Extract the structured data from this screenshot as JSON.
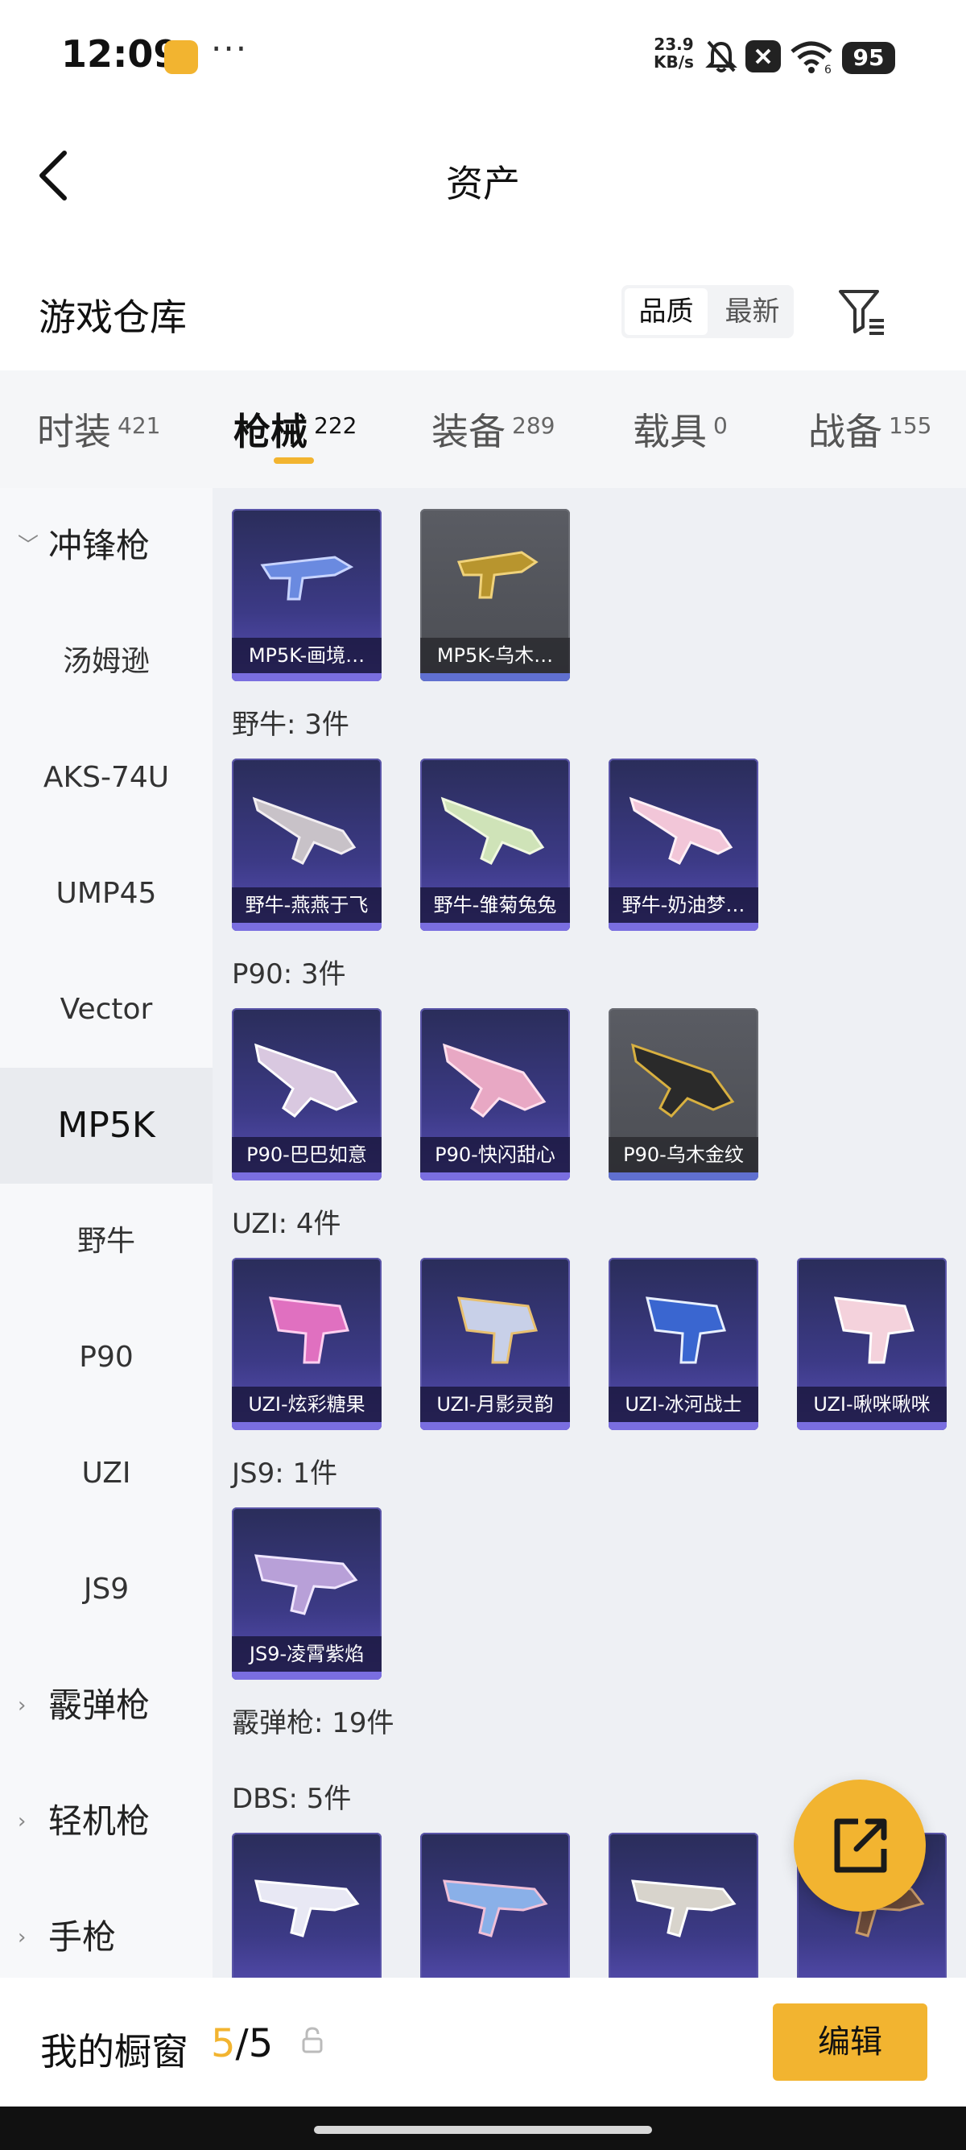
{
  "status_bar": {
    "time": "12:09",
    "more": "···",
    "speed_value": "23.9",
    "speed_unit": "KB/s",
    "battery": "95",
    "wifi_level": "6"
  },
  "header": {
    "title": "资产"
  },
  "warehouse": {
    "title": "游戏仓库",
    "sort_options": [
      "品质",
      "最新"
    ],
    "active_sort": "品质"
  },
  "tabs": [
    {
      "label": "时装",
      "count": "421"
    },
    {
      "label": "枪械",
      "count": "222"
    },
    {
      "label": "装备",
      "count": "289"
    },
    {
      "label": "载具",
      "count": "0"
    },
    {
      "label": "战备",
      "count": "155"
    }
  ],
  "active_tab": "枪械",
  "sidebar": {
    "items": [
      {
        "label": "冲锋枪",
        "group": true,
        "expanded": true
      },
      {
        "label": "汤姆逊"
      },
      {
        "label": "AKS-74U"
      },
      {
        "label": "UMP45"
      },
      {
        "label": "Vector"
      },
      {
        "label": "MP5K",
        "active": true
      },
      {
        "label": "野牛"
      },
      {
        "label": "P90"
      },
      {
        "label": "UZI"
      },
      {
        "label": "JS9"
      },
      {
        "label": "霰弹枪",
        "group": true
      },
      {
        "label": "轻机枪",
        "group": true
      },
      {
        "label": "手枪",
        "group": true
      }
    ]
  },
  "content": {
    "mp5k_items": [
      {
        "label": "MP5K-画境…",
        "quality": "purple"
      },
      {
        "label": "MP5K-乌木…",
        "quality": "gray"
      }
    ],
    "sections": [
      {
        "title": "野牛: 3件",
        "items": [
          {
            "label": "野牛-燕燕于飞",
            "quality": "purple"
          },
          {
            "label": "野牛-雏菊兔兔",
            "quality": "purple"
          },
          {
            "label": "野牛-奶油梦…",
            "quality": "purple"
          }
        ]
      },
      {
        "title": "P90: 3件",
        "items": [
          {
            "label": "P90-巴巴如意",
            "quality": "purple"
          },
          {
            "label": "P90-快闪甜心",
            "quality": "purple"
          },
          {
            "label": "P90-乌木金纹",
            "quality": "gray"
          }
        ]
      },
      {
        "title": "UZI: 4件",
        "items": [
          {
            "label": "UZI-炫彩糖果",
            "quality": "purple"
          },
          {
            "label": "UZI-月影灵韵",
            "quality": "purple"
          },
          {
            "label": "UZI-冰河战士",
            "quality": "purple"
          },
          {
            "label": "UZI-啾咪啾咪",
            "quality": "purple"
          }
        ]
      },
      {
        "title": "JS9: 1件",
        "items": [
          {
            "label": "JS9-凌霄紫焰",
            "quality": "purple"
          }
        ]
      }
    ],
    "shotgun_title": "霰弹枪: 19件",
    "dbs_title": "DBS: 5件"
  },
  "showcase": {
    "label": "我的橱窗",
    "used": "5",
    "separator": "/",
    "total": "5",
    "edit_label": "编辑"
  },
  "colors": {
    "accent": "#f2b430",
    "card_purple": "#3c3a86",
    "card_gray": "#55575d"
  }
}
